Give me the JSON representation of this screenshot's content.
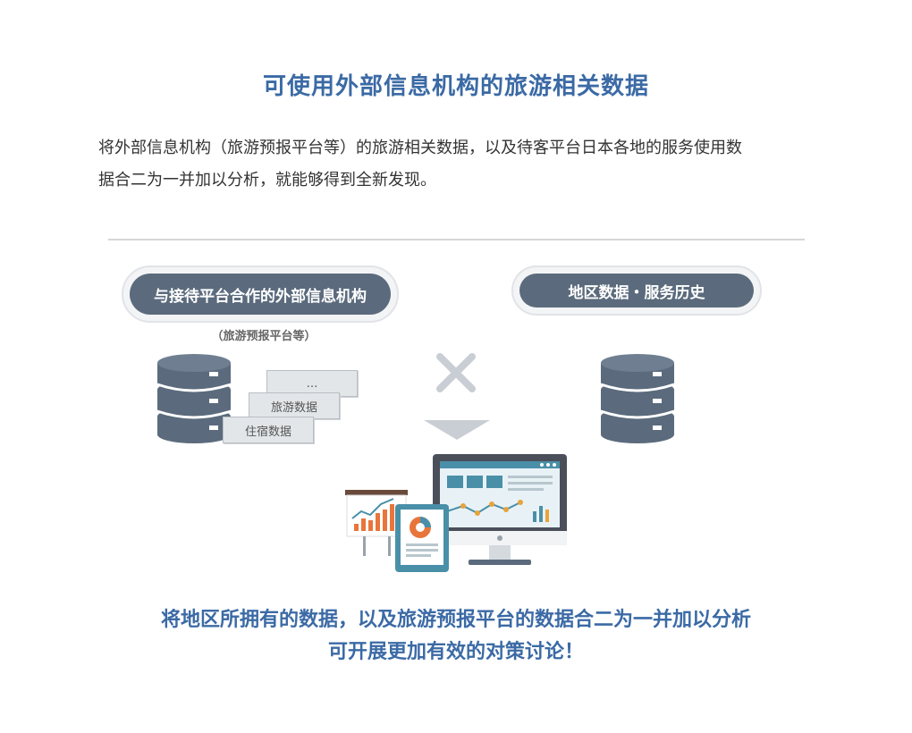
{
  "title": "可使用外部信息机构的旅游相关数据",
  "description": {
    "line1": "将外部信息机构（旅游预报平台等）的旅游相关数据，以及待客平台日本各地的服务使用数",
    "line2": "据合二为一并加以分析，就能够得到全新发现。"
  },
  "diagram": {
    "left_label": "与接待平台合作的外部信息机构",
    "left_note": "（旅游预报平台等）",
    "right_label": "地区数据・服务历史",
    "cards": [
      "…",
      "旅游数据",
      "住宿数据"
    ]
  },
  "conclusion": {
    "line1": "将地区所拥有的数据，以及旅游预报平台的数据合二为一并加以分析",
    "line2": "可开展更加有效的对策讨论！"
  },
  "colors": {
    "accent": "#3b6aa5",
    "database": "#5b6b7d",
    "screen": "#4a8fa8",
    "chart_orange": "#e8753b"
  }
}
